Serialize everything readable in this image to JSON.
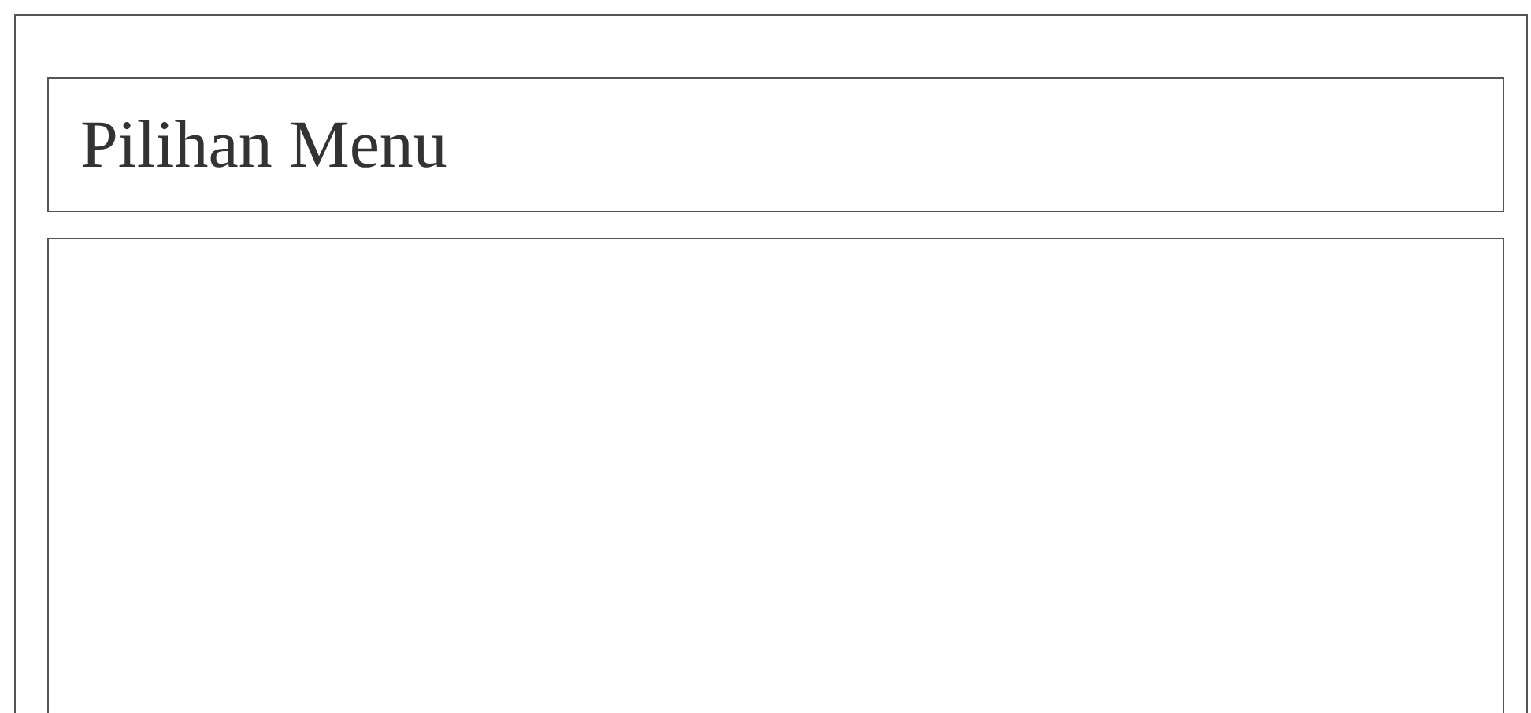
{
  "header": {
    "title": "Pilihan Menu"
  }
}
